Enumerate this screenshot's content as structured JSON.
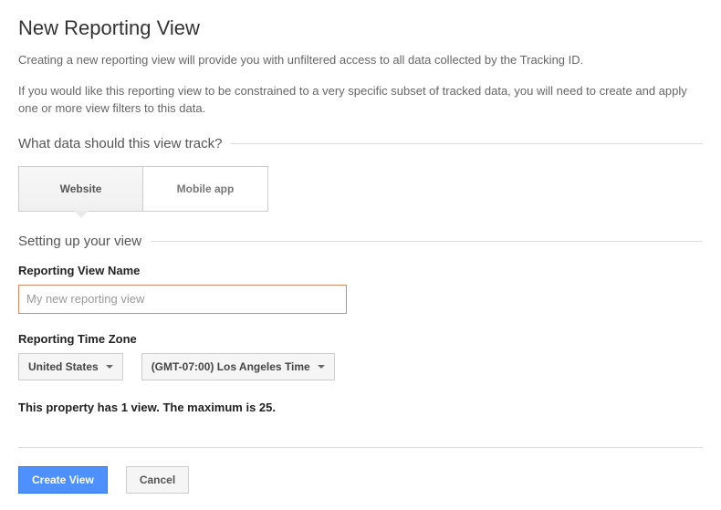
{
  "title": "New Reporting View",
  "intro1": "Creating a new reporting view will provide you with unfiltered access to all data collected by the Tracking ID.",
  "intro2": "If you would like this reporting view to be constrained to a very specific subset of tracked data, you will need to create and apply one or more view filters to this data.",
  "section1": "What data should this view track?",
  "tabs": {
    "website": "Website",
    "mobile": "Mobile app"
  },
  "section2": "Setting up your view",
  "fields": {
    "nameLabel": "Reporting View Name",
    "nameValue": "My new reporting view",
    "tzLabel": "Reporting Time Zone",
    "country": "United States",
    "tz": "(GMT-07:00) Los Angeles Time"
  },
  "propertyInfo": "This property has 1 view. The maximum is 25.",
  "buttons": {
    "create": "Create View",
    "cancel": "Cancel"
  }
}
